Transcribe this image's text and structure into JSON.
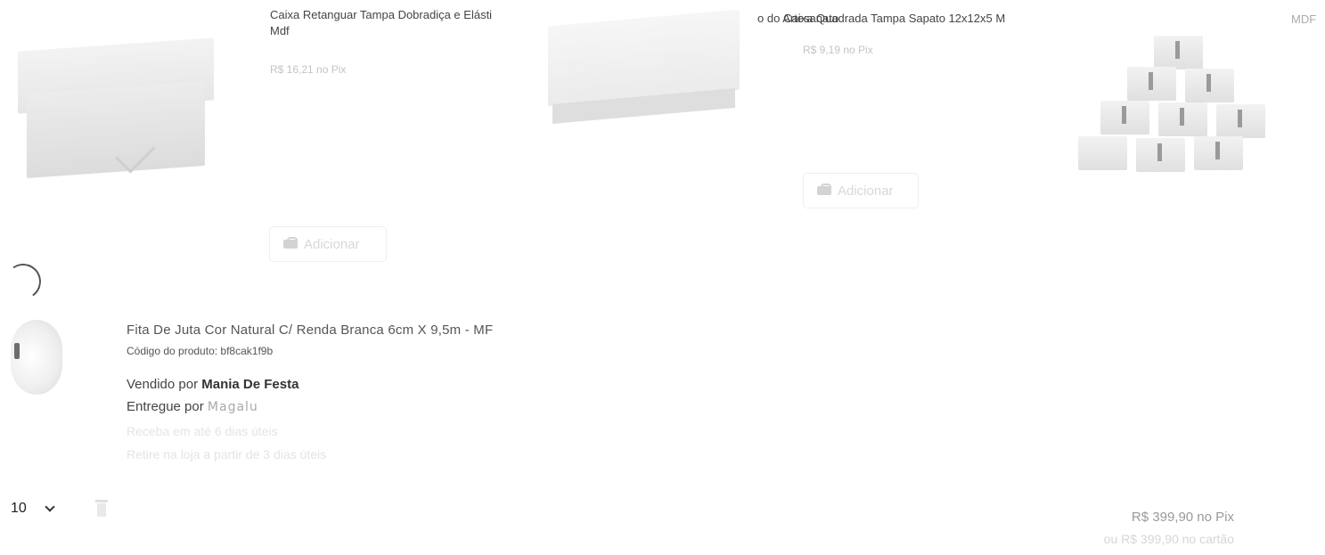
{
  "recommendations": [
    {
      "title": "Caixa Retanguar Tampa Dobradiça e Elásti",
      "title_line2": "Mdf",
      "price": "R$ 16,21 no Pix",
      "add_label": "Adicionar",
      "image_icon": "box-with-clasp-icon"
    },
    {
      "title_fragment": "o do Artesanato",
      "title": "Caixa Quadrada Tampa Sapato 12x12x5 M",
      "price": "R$ 9,19 no Pix",
      "add_label": "Adicionar",
      "image_icon": "square-box-icon"
    },
    {
      "title_fragment": "MDF",
      "image_icon": "stacked-boxes-icon"
    }
  ],
  "cart_item": {
    "title": "Fita De Juta Cor Natural C/ Renda Branca 6cm X 9,5m - MF",
    "code": "Código do produto: bf8cak1f9b",
    "sold_by_prefix": "Vendido por",
    "sold_by": "Mania De Festa",
    "delivered_by_prefix": "Entregue por",
    "delivered_by": "Magalu",
    "delivery_estimate": "Receba em até 6 dias úteis",
    "pickup_estimate": "Retire na loja a partir de 3 dias úteis",
    "quantity": "10",
    "image_icon": "ribbon-roll-icon"
  },
  "totals": {
    "pix": "R$ 399,90 no Pix",
    "card": "ou R$ 399,90 no cartão"
  },
  "colors": {
    "text": "#444444",
    "faint": "#c4c4c4",
    "very_faint": "#e4e4e4"
  }
}
